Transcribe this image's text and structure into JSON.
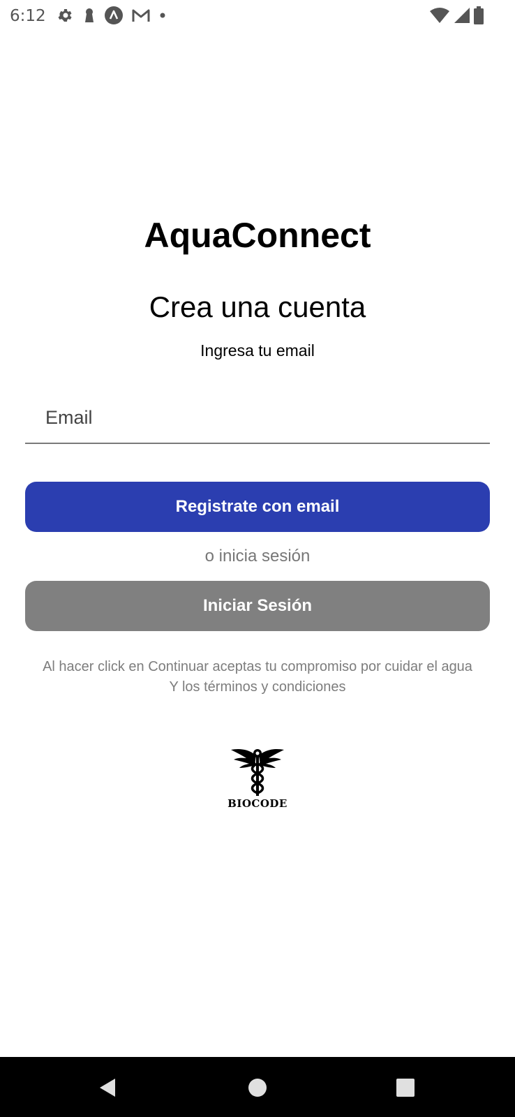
{
  "status_bar": {
    "time": "6:12",
    "left_icons": [
      "settings-icon",
      "keyhole-icon",
      "app-a-icon",
      "gmail-icon",
      "dot-icon"
    ],
    "right_icons": [
      "wifi-icon",
      "signal-icon",
      "battery-icon"
    ]
  },
  "app": {
    "title": "AquaConnect",
    "heading": "Crea una cuenta",
    "subheading": "Ingresa tu email"
  },
  "form": {
    "email_placeholder": "Email",
    "email_value": "",
    "register_button": "Registrate con email",
    "or_text": "o inicia sesión",
    "login_button": "Iniciar Sesión"
  },
  "terms": {
    "line1": "Al hacer click en Continuar aceptas tu compromiso por cuidar el agua",
    "line2": "Y los términos y condiciones"
  },
  "logo": {
    "text": "BIOCODE",
    "icon": "caduceus-logo"
  },
  "nav_bar": {
    "icons": [
      "back-icon",
      "home-icon",
      "recents-icon"
    ]
  },
  "colors": {
    "primary": "#2b3eb0",
    "secondary_button": "#808080",
    "muted_text": "#7d7d7d",
    "nav_bg": "#000000"
  }
}
